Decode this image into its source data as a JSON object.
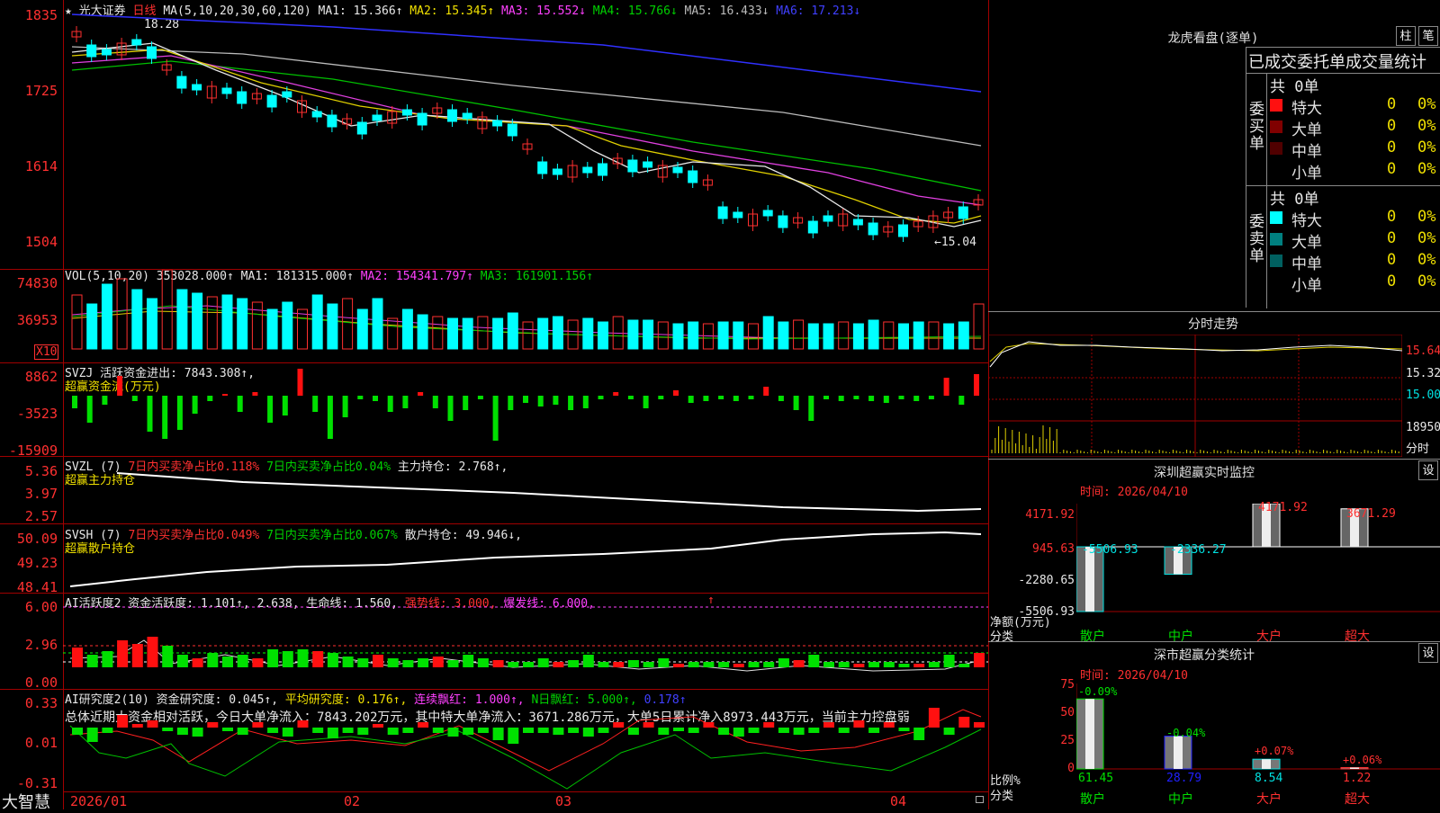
{
  "stock": {
    "star": "★",
    "name": "光大证券",
    "period": "日线"
  },
  "ma_line": {
    "label": "MA(5,10,20,30,60,120)",
    "ma1": "MA1: 15.366↑",
    "ma2": "MA2: 15.345↑",
    "ma3": "MA3: 15.552↓",
    "ma4": "MA4: 15.766↓",
    "ma5": "MA5: 16.433↓",
    "ma6": "MA6: 17.213↓"
  },
  "price_axis": [
    "1835",
    "1725",
    "1614",
    "1504"
  ],
  "price_marks": {
    "high": "18.28",
    "low": "←15.04"
  },
  "vol": {
    "label": "VOL(5,10,20) 353028.000↑",
    "ma1": "MA1: 181315.000↑",
    "ma2": "MA2: 154341.797↑",
    "ma3": "MA3: 161901.156↑",
    "axis": [
      "74830",
      "36953"
    ],
    "unit": "X10"
  },
  "svzj": {
    "label": "SVZJ  活跃资金进出: 7843.308↑,",
    "sub": "超赢资金流(万元)",
    "axis": [
      "8862",
      "-3523",
      "-15909"
    ]
  },
  "svzl": {
    "label": "SVZL (7)",
    "a": "7日内买卖净占比0.118%",
    "b": "7日内买卖净占比0.04%",
    "c": "主力持仓: 2.768↑,",
    "sub": "超赢主力持仓",
    "axis": [
      "5.36",
      "3.97",
      "2.57"
    ]
  },
  "svsh": {
    "label": "SVSH (7)",
    "a": "7日内买卖净占比0.049%",
    "b": "7日内买卖净占比0.067%",
    "c": "散户持仓: 49.946↓,",
    "sub": "超赢散户持仓",
    "axis": [
      "50.09",
      "49.23",
      "48.41"
    ]
  },
  "ai_active": {
    "label": "AI活跃度2 资金活跃度: 1.101↑, 2.638,",
    "life": "生命线: 1.560,",
    "strong": "强势线: 3.000,",
    "burst": "爆发线: 6.000,",
    "arrow": "↑",
    "axis": [
      "6.00",
      "2.96",
      "0.00"
    ]
  },
  "ai_research": {
    "label": "AI研究度2(10) 资金研究度: 0.045↑,",
    "avg": "平均研究度: 0.176↑,",
    "cont": "连续飘红: 1.000↑,",
    "nday": "N日飘红: 5.000↑,",
    "last": "0.178↑",
    "summary": "总体近期大资金相对活跃，今日大单净流入：7843.202万元，其中特大单净流入：3671.286万元，大单5日累计净入8973.443万元，当前主力控盘弱",
    "axis": [
      "0.33",
      "0.01",
      "-0.31"
    ]
  },
  "date_axis": [
    "2026/01",
    "02",
    "03",
    "04"
  ],
  "brand": "大智慧",
  "right": {
    "lhb_title": "龙虎看盘(逐单)",
    "btn_zhu": "柱",
    "btn_bi": "笔",
    "stats_title": "已成交委托单成交量统计",
    "buy_label": "委买单",
    "sell_label": "委卖单",
    "buy_total": "共 0单",
    "sell_total": "共 0单",
    "buy_rows": [
      {
        "name": "特大",
        "count": "0",
        "pct": "0%",
        "color": "#ff1010"
      },
      {
        "name": "大单",
        "count": "0",
        "pct": "0%",
        "color": "#800000"
      },
      {
        "name": "中单",
        "count": "0",
        "pct": "0%",
        "color": "#500000"
      },
      {
        "name": "小单",
        "count": "0",
        "pct": "0%",
        "color": ""
      }
    ],
    "sell_rows": [
      {
        "name": "特大",
        "count": "0",
        "pct": "0%",
        "color": "#00ffff"
      },
      {
        "name": "大单",
        "count": "0",
        "pct": "0%",
        "color": "#008080"
      },
      {
        "name": "中单",
        "count": "0",
        "pct": "0%",
        "color": "#006060"
      },
      {
        "name": "小单",
        "count": "0",
        "pct": "0%",
        "color": ""
      }
    ],
    "intraday_title": "分时走势",
    "intraday_axis": [
      "15.64",
      "15.32",
      "15.00",
      "18950",
      "分时"
    ],
    "sz_title": "深圳超赢实时监控",
    "btn_set": "设",
    "sz_time": "时间: 2026/04/10",
    "sz_axis": [
      "4171.92",
      "945.63",
      "-2280.65",
      "-5506.93"
    ],
    "sz_values": [
      "-5506.93",
      "-2336.27",
      "4171.92",
      "3671.29"
    ],
    "sz_unit": "净额(万元)",
    "sz_class": "分类",
    "cats": [
      "散户",
      "中户",
      "大户",
      "超大"
    ],
    "sc_title": "深市超赢分类统计",
    "sc_time": "时间: 2026/04/10",
    "sc_axis": [
      "75",
      "50",
      "25",
      "0"
    ],
    "sc_changes": [
      "-0.09%",
      "-0.04%",
      "+0.07%",
      "+0.06%"
    ],
    "sc_values": [
      "61.45",
      "28.79",
      "8.54",
      "1.22"
    ],
    "sc_unit": "比例%",
    "sc_class": "分类"
  }
}
